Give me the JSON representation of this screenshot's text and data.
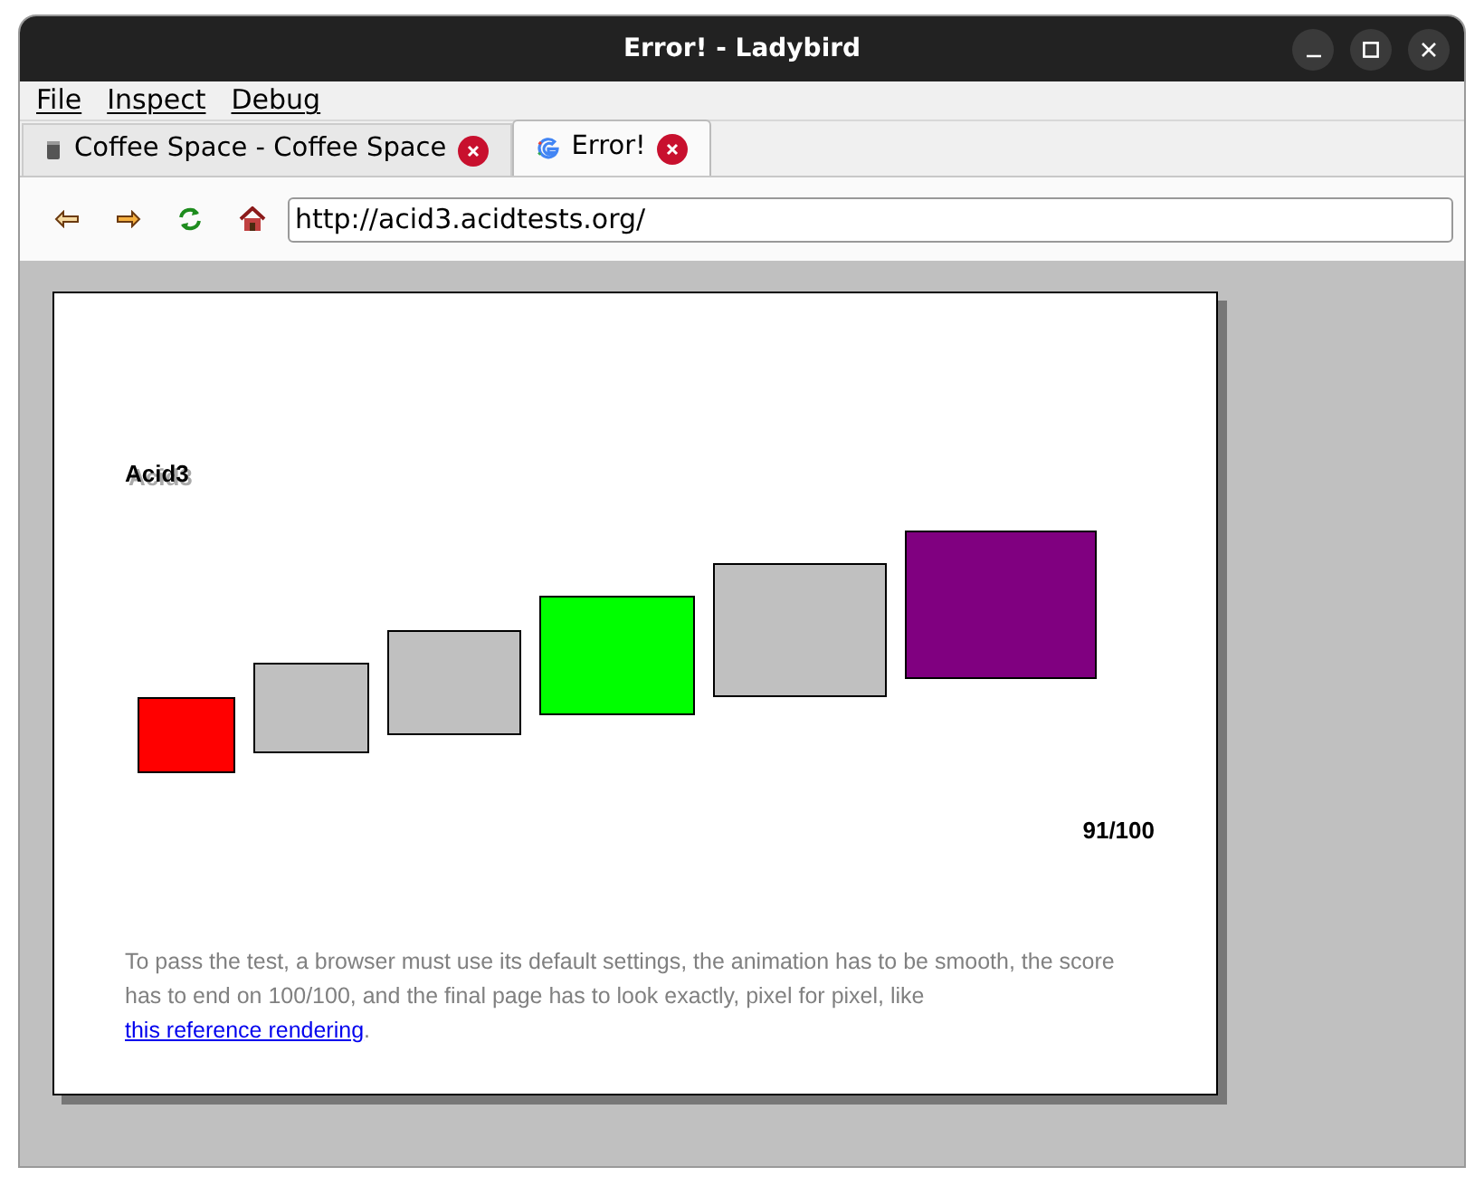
{
  "window": {
    "title": "Error! - Ladybird"
  },
  "menu": [
    "File",
    "Inspect",
    "Debug"
  ],
  "tabs": [
    {
      "label": "Coffee Space - Coffee Space",
      "selected": false,
      "kind": "cup"
    },
    {
      "label": "Error!",
      "selected": true,
      "kind": "google"
    }
  ],
  "address": {
    "value": "http://acid3.acidtests.org/"
  },
  "page": {
    "heading": "Acid3",
    "score": "91/100",
    "boxes": [
      {
        "color": "#ff0000"
      },
      {
        "color": "#c0c0c0"
      },
      {
        "color": "#c0c0c0"
      },
      {
        "color": "#00ff00"
      },
      {
        "color": "#c0c0c0"
      },
      {
        "color": "#800080"
      }
    ],
    "note": "To pass the test, a browser must use its default settings, the animation has to be smooth, the score has to end on 100/100, and the final page has to look exactly, pixel for pixel, like",
    "link": "this reference rendering",
    "note_end": "."
  }
}
